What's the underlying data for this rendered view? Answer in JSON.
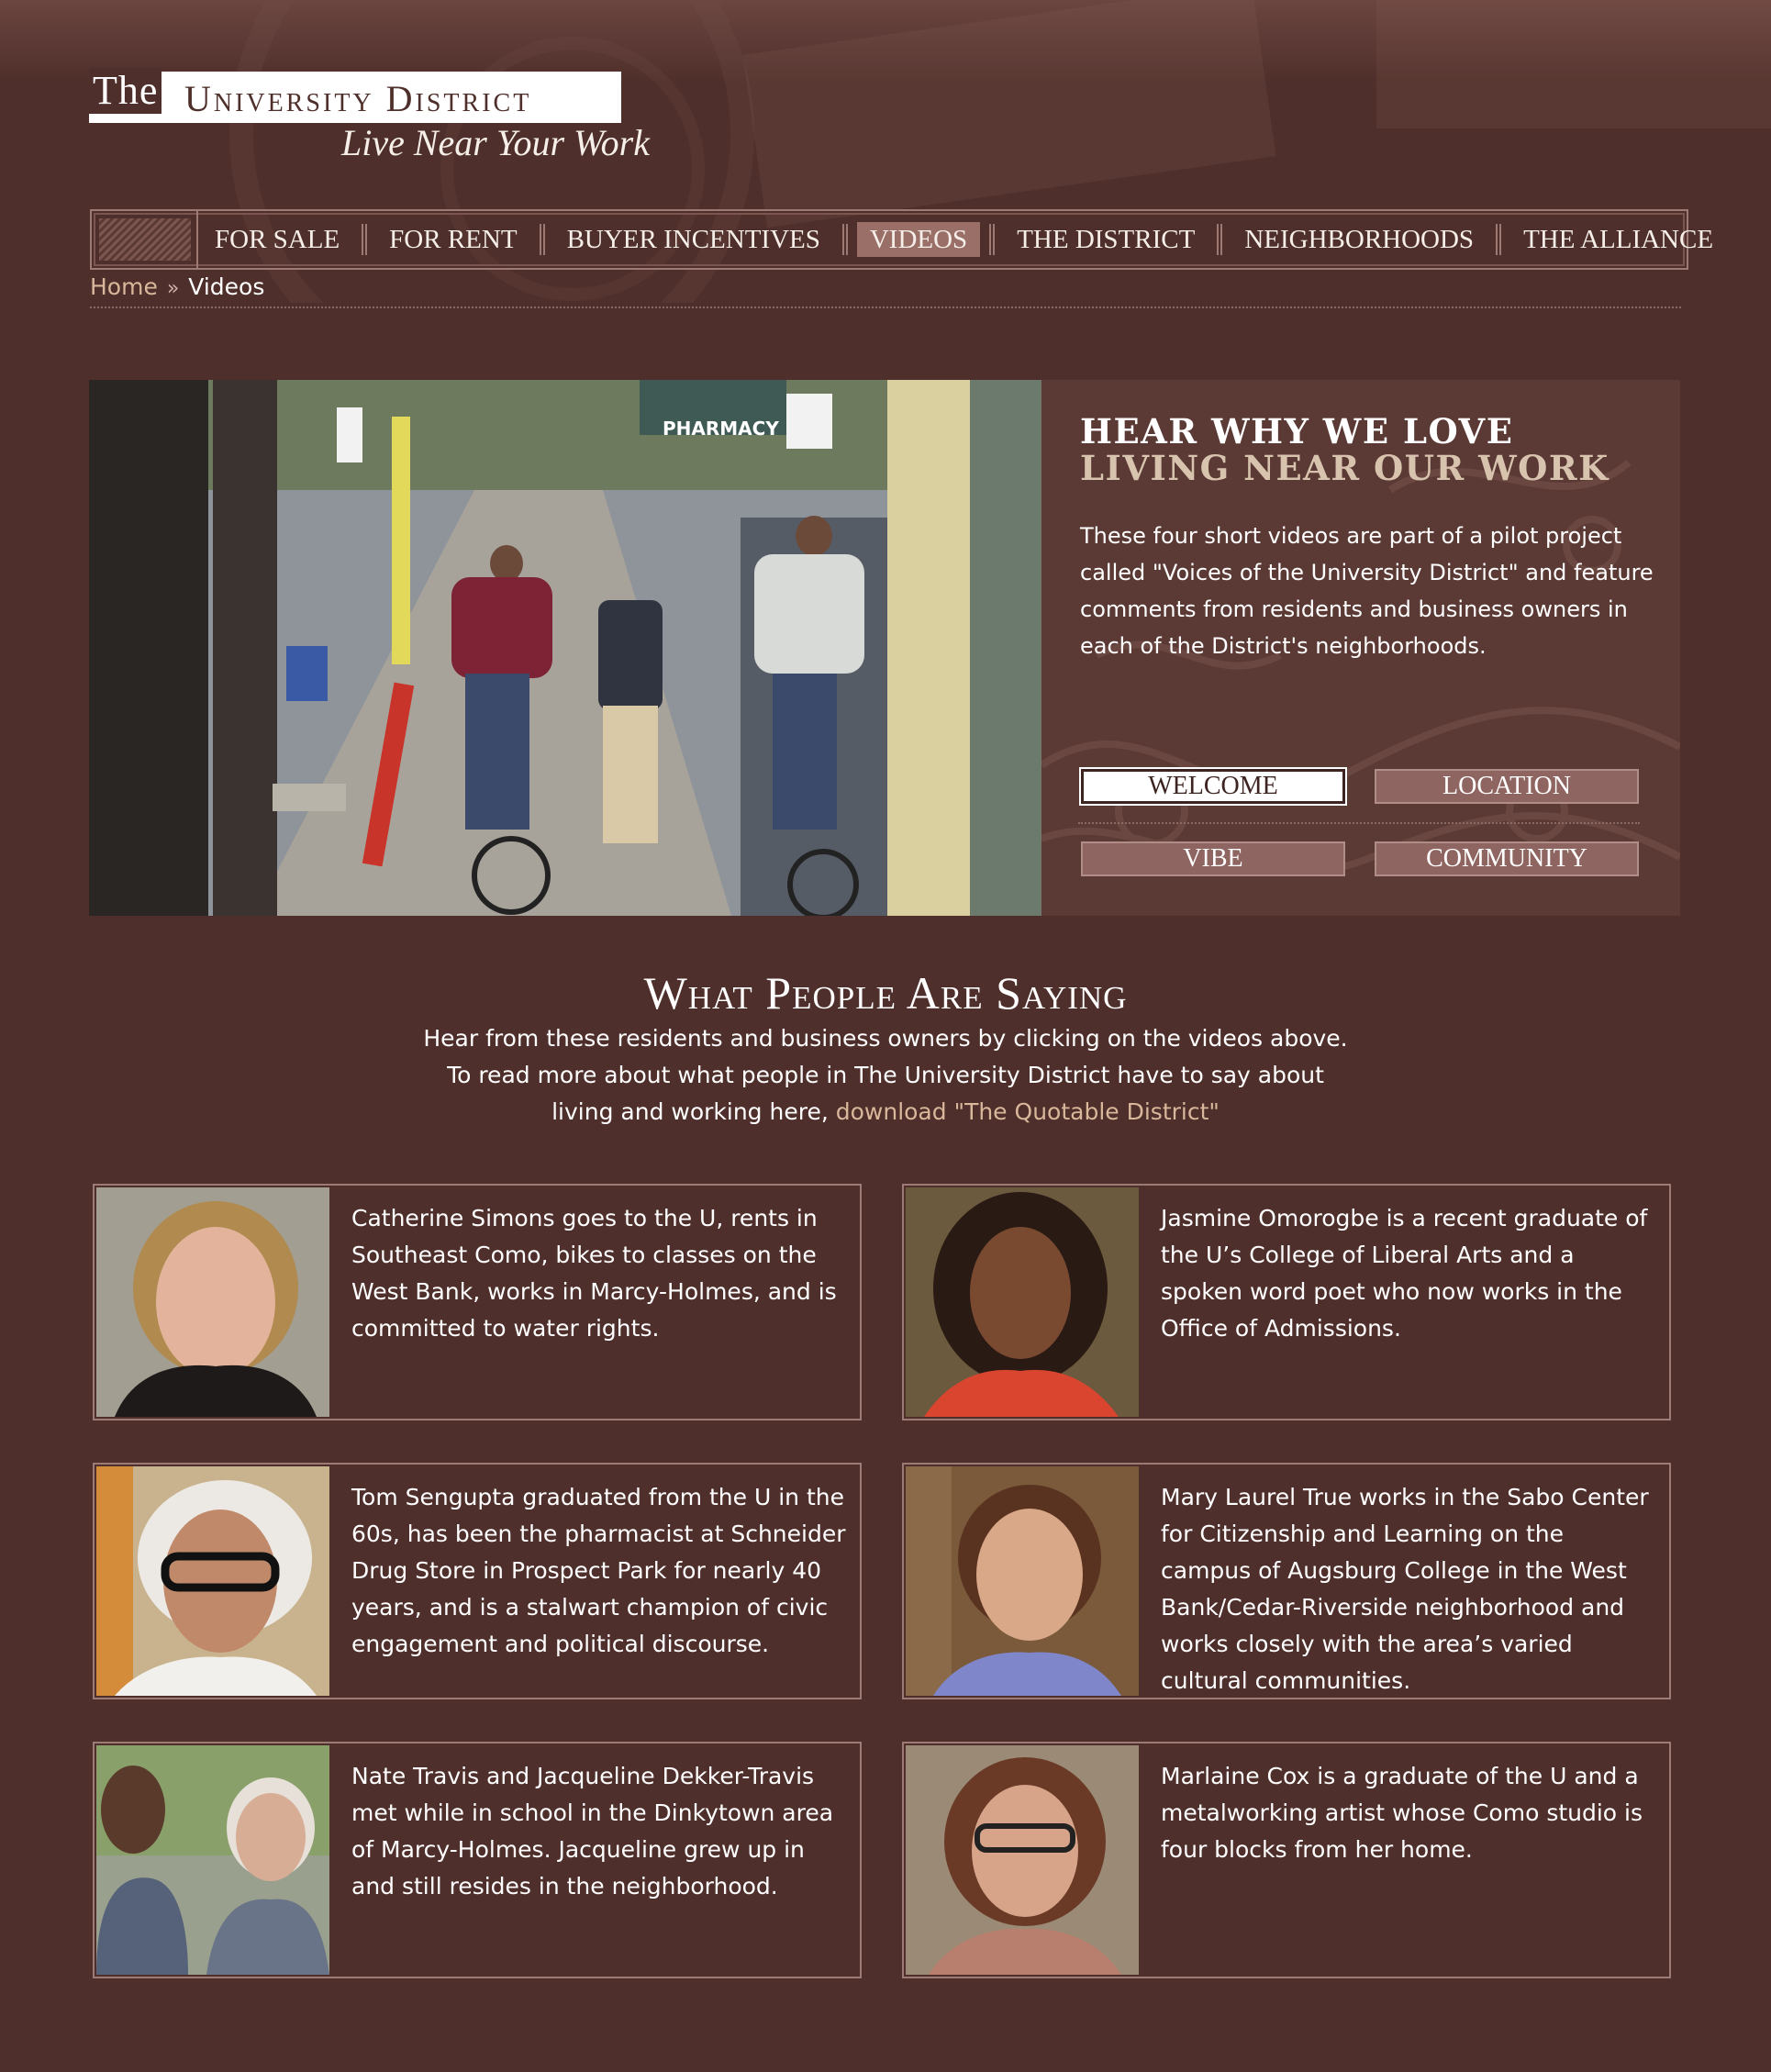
{
  "logo": {
    "the": "The",
    "name": "University District",
    "tagline": "Live Near Your Work"
  },
  "nav": {
    "items": [
      {
        "label": "FOR SALE",
        "active": false
      },
      {
        "label": "FOR RENT",
        "active": false
      },
      {
        "label": "BUYER INCENTIVES",
        "active": false
      },
      {
        "label": "VIDEOS",
        "active": true
      },
      {
        "label": "THE DISTRICT",
        "active": false
      },
      {
        "label": "NEIGHBORHOODS",
        "active": false
      },
      {
        "label": "THE ALLIANCE",
        "active": false
      }
    ]
  },
  "breadcrumb": {
    "home": "Home",
    "separator": "»",
    "current": "Videos"
  },
  "hero": {
    "video_sign": "PHARMACY",
    "heading_line1": "HEAR WHY WE LOVE",
    "heading_line2": "LIVING NEAR OUR WORK",
    "intro": "These four short videos are part of a pilot project called \"Voices of the University District\" and feature comments from residents and business owners in each of the District's neighborhoods.",
    "buttons": {
      "welcome": "WELCOME",
      "location": "LOCATION",
      "vibe": "VIBE",
      "community": "COMMUNITY"
    },
    "selected": "WELCOME"
  },
  "saying": {
    "title": "What People Are Saying",
    "line1": "Hear from these residents and business owners by clicking on the videos above.",
    "line2": "To read more about what people in The University District have to say about living and working here,",
    "link": "download \"The Quotable District\""
  },
  "people": [
    {
      "text": "Catherine Simons goes to the U, rents in Southeast Como, bikes to classes on the West Bank, works in Marcy-Holmes, and is committed to water rights."
    },
    {
      "text": "Jasmine Omorogbe is a recent graduate of the U’s College of Liberal Arts and a spoken word poet who now works in the Office of Admissions."
    },
    {
      "text": "Tom Sengupta graduated from the U in the 60s, has been the pharmacist at Schneider Drug Store in Prospect Park for nearly 40 years, and is a stalwart champion of civic engagement and political discourse."
    },
    {
      "text": "Mary Laurel True works in the Sabo Center for Citizenship and Learning on the campus of Augsburg College in the West Bank/Cedar-Riverside neighborhood and works closely with the area’s varied cultural communities."
    },
    {
      "text": "Nate Travis and Jacqueline Dekker-Travis met while in school in the Dinkytown area of Marcy-Holmes. Jacqueline grew up in and still resides in the neighborhood."
    },
    {
      "text": "Marlaine Cox is a graduate of the U and a metalworking artist whose Como studio is four blocks from her home."
    }
  ],
  "colors": {
    "background": "#4f2f2b",
    "accent": "#9a6f68",
    "link": "#d8b79a"
  }
}
